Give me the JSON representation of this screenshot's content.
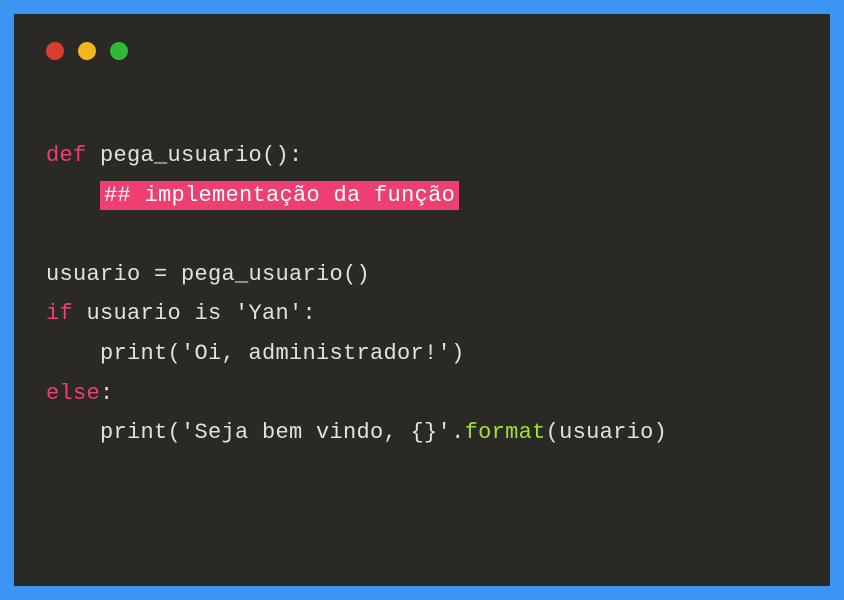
{
  "code": {
    "line1_kw": "def",
    "line1_rest": " pega_usuario():",
    "line2_indent": "    ",
    "line2_comment": "## implementação da função",
    "line3": "",
    "line4": "usuario = pega_usuario()",
    "line5_kw": "if",
    "line5_rest": " usuario is 'Yan':",
    "line6": "    print('Oi, administrador!')",
    "line7_kw": "else",
    "line7_rest": ":",
    "line8_a": "    print('Seja bem vindo, {}'.",
    "line8_method": "format",
    "line8_b": "(usuario)"
  },
  "traffic_lights": {
    "red": "close",
    "yellow": "minimize",
    "green": "maximize"
  }
}
